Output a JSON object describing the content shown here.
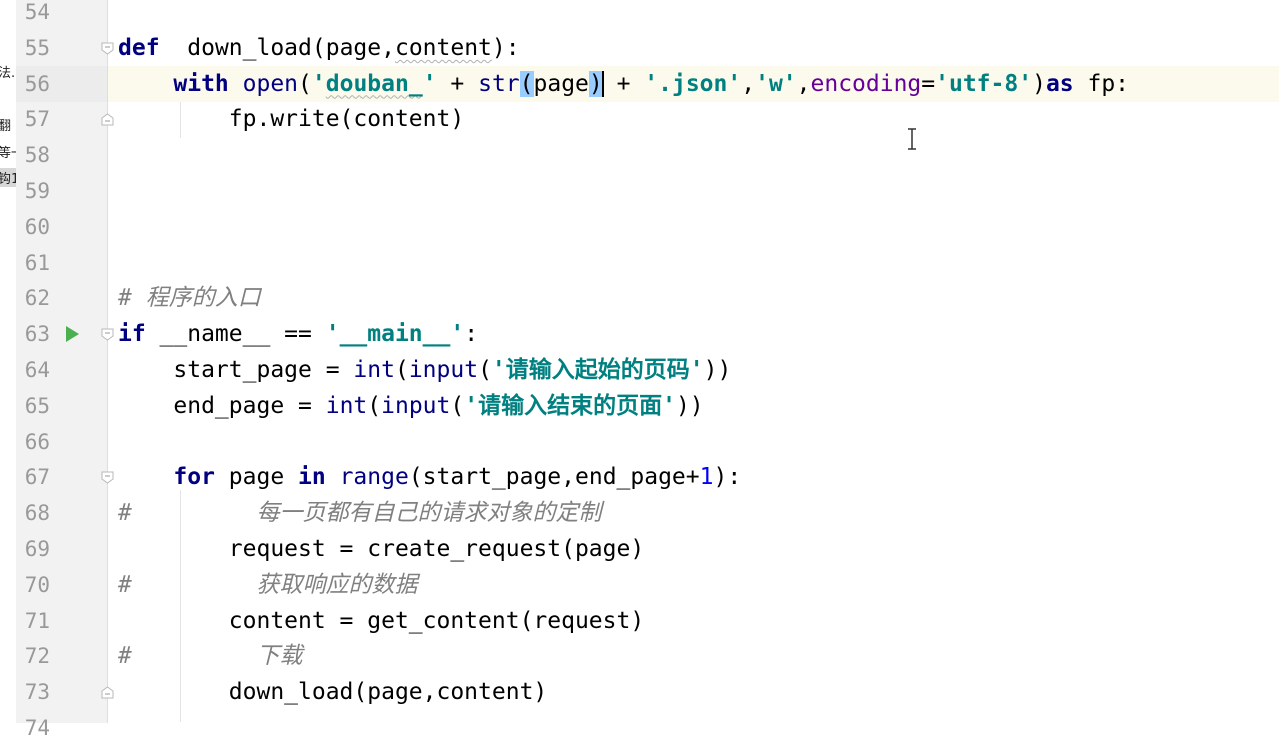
{
  "left_panel_fragments": [
    "法.",
    "翻",
    "等一",
    "钩1"
  ],
  "lines": [
    {
      "n": "54",
      "tokens": []
    },
    {
      "n": "55",
      "tokens": [
        [
          "kw",
          "def"
        ],
        [
          "",
          "  "
        ],
        [
          "",
          "down_load(page,"
        ],
        [
          "wavy",
          "content"
        ],
        [
          "",
          "):"
        ]
      ]
    },
    {
      "n": "56",
      "tokens": [
        [
          "",
          "    "
        ],
        [
          "kw",
          "with "
        ],
        [
          "bi",
          "open"
        ],
        [
          "",
          "("
        ],
        [
          "str",
          "'"
        ],
        [
          "str wavy",
          "douban_"
        ],
        [
          "str",
          "'"
        ],
        [
          "",
          " + "
        ],
        [
          "bi",
          "str"
        ],
        [
          "brace",
          "("
        ],
        [
          "",
          "page"
        ],
        [
          "brace",
          ")"
        ],
        [
          "caret",
          ""
        ],
        [
          "",
          " + "
        ],
        [
          "str",
          "'.json'"
        ],
        [
          "",
          ","
        ],
        [
          "str",
          "'w'"
        ],
        [
          "",
          ","
        ],
        [
          "param",
          "encoding"
        ],
        [
          "",
          "="
        ],
        [
          "str",
          "'utf-8'"
        ],
        [
          "",
          ")"
        ],
        [
          "kw",
          "as"
        ],
        [
          "",
          " fp:"
        ]
      ]
    },
    {
      "n": "57",
      "tokens": [
        [
          "",
          "        fp.write(content)"
        ]
      ]
    },
    {
      "n": "58",
      "tokens": []
    },
    {
      "n": "59",
      "tokens": []
    },
    {
      "n": "60",
      "tokens": []
    },
    {
      "n": "61",
      "tokens": []
    },
    {
      "n": "62",
      "tokens": [
        [
          "cmt",
          "# "
        ],
        [
          "cmt-cn",
          "程序的入口"
        ]
      ]
    },
    {
      "n": "63",
      "tokens": [
        [
          "kw",
          "if "
        ],
        [
          "",
          "__name__ == "
        ],
        [
          "str",
          "'__main__'"
        ],
        [
          "",
          ":"
        ]
      ]
    },
    {
      "n": "64",
      "tokens": [
        [
          "",
          "    start_page = "
        ],
        [
          "bi",
          "int"
        ],
        [
          "",
          "("
        ],
        [
          "bi",
          "input"
        ],
        [
          "",
          "("
        ],
        [
          "str",
          "'"
        ],
        [
          "cn",
          "请输入起始的页码"
        ],
        [
          "str",
          "'"
        ],
        [
          "",
          "))"
        ]
      ]
    },
    {
      "n": "65",
      "tokens": [
        [
          "",
          "    end_page = "
        ],
        [
          "bi",
          "int"
        ],
        [
          "",
          "("
        ],
        [
          "bi",
          "input"
        ],
        [
          "",
          "("
        ],
        [
          "str",
          "'"
        ],
        [
          "cn",
          "请输入结束的页面"
        ],
        [
          "str",
          "'"
        ],
        [
          "",
          "))"
        ]
      ]
    },
    {
      "n": "66",
      "tokens": []
    },
    {
      "n": "67",
      "tokens": [
        [
          "",
          "    "
        ],
        [
          "kw",
          "for "
        ],
        [
          "",
          "page "
        ],
        [
          "kw",
          "in "
        ],
        [
          "bi",
          "range"
        ],
        [
          "",
          "(start_page,end_page+"
        ],
        [
          "num",
          "1"
        ],
        [
          "",
          "):"
        ]
      ]
    },
    {
      "n": "68",
      "tokens": [
        [
          "cmt",
          "#         "
        ],
        [
          "cmt-cn",
          "每一页都有自己的请求对象的定制"
        ]
      ]
    },
    {
      "n": "69",
      "tokens": [
        [
          "",
          "        request = create_request(page)"
        ]
      ]
    },
    {
      "n": "70",
      "tokens": [
        [
          "cmt",
          "#         "
        ],
        [
          "cmt-cn",
          "获取响应的数据"
        ]
      ]
    },
    {
      "n": "71",
      "tokens": [
        [
          "",
          "        content = get_content(request)"
        ]
      ]
    },
    {
      "n": "72",
      "tokens": [
        [
          "cmt",
          "#         "
        ],
        [
          "cmt-cn",
          "下载"
        ]
      ]
    },
    {
      "n": "73",
      "tokens": [
        [
          "",
          "        down_load(page,content)"
        ]
      ]
    },
    {
      "n": "74",
      "tokens": []
    }
  ],
  "current_line": "56",
  "run_line": "63",
  "fold_lines": [
    "55",
    "57",
    "63",
    "67",
    "73"
  ],
  "colors": {
    "keyword": "#000080",
    "string": "#008080",
    "comment": "#808080",
    "number": "#0000ff",
    "param": "#660099",
    "current_line": "#fcfaed",
    "gutter": "#f2f2f2",
    "run_icon": "#4caf50"
  },
  "icons": {
    "run": "run-arrow-icon",
    "fold": "fold-marker-icon",
    "cursor": "text-cursor-icon"
  }
}
